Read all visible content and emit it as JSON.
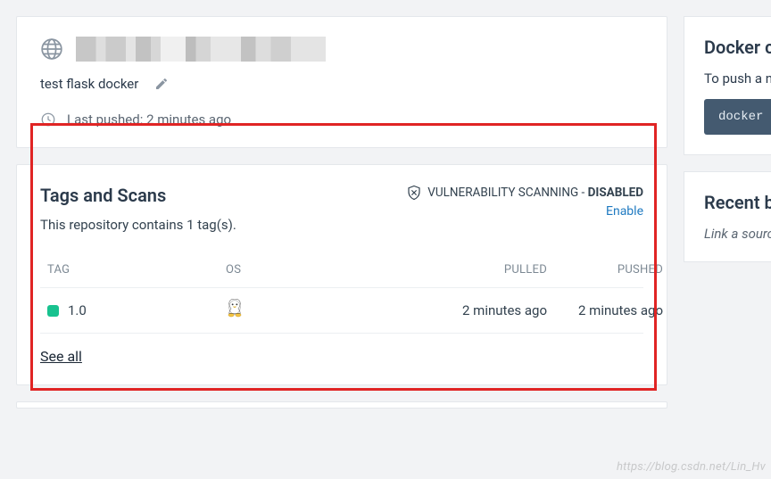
{
  "header": {
    "description": "test flask docker",
    "last_pushed_label": "Last pushed:",
    "last_pushed_value": "2 minutes ago"
  },
  "tags_card": {
    "title": "Tags and Scans",
    "subtitle": "This repository contains 1 tag(s).",
    "vuln_label": "VULNERABILITY SCANNING - ",
    "vuln_status": "DISABLED",
    "vuln_action": "Enable",
    "columns": {
      "tag": "TAG",
      "os": "OS",
      "pulled": "PULLED",
      "pushed": "PUSHED"
    },
    "rows": [
      {
        "tag": "1.0",
        "os": "linux",
        "pulled": "2 minutes ago",
        "pushed": "2 minutes ago"
      }
    ],
    "see_all": "See all"
  },
  "side_push": {
    "title": "Docker commands",
    "line": "To push a new tag to this repository,",
    "code": "docker push"
  },
  "side_builds": {
    "title": "Recent builds",
    "line": "Link a source provider"
  },
  "watermark": "https://blog.csdn.net/Lin_Hv"
}
